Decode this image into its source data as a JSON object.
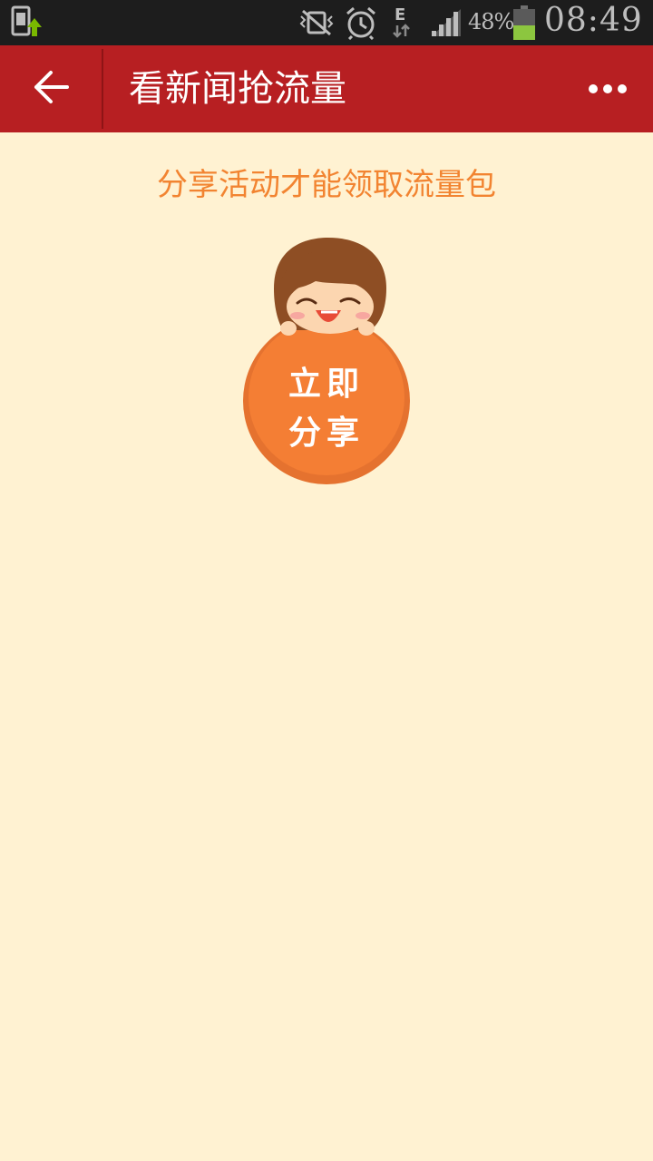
{
  "status_bar": {
    "network_type": "E",
    "battery_percent": "48%",
    "battery_level": 0.48,
    "time": "08:49",
    "icons": [
      "phone-upload-icon",
      "vibrate-icon",
      "alarm-icon",
      "data-transfer-icon",
      "signal-icon",
      "battery-icon"
    ]
  },
  "app_bar": {
    "title": "看新闻抢流量",
    "back_icon": "arrow-left-icon",
    "more_icon": "more-dots-icon"
  },
  "content": {
    "headline": "分享活动才能领取流量包",
    "share_button": {
      "line1": "立即",
      "line2": "分享"
    }
  },
  "colors": {
    "status_bar_bg": "#1D1D1D",
    "app_bar_bg": "#B71F22",
    "page_bg": "#FFF2D2",
    "accent_orange": "#F28431",
    "button_orange": "#F47E34"
  }
}
